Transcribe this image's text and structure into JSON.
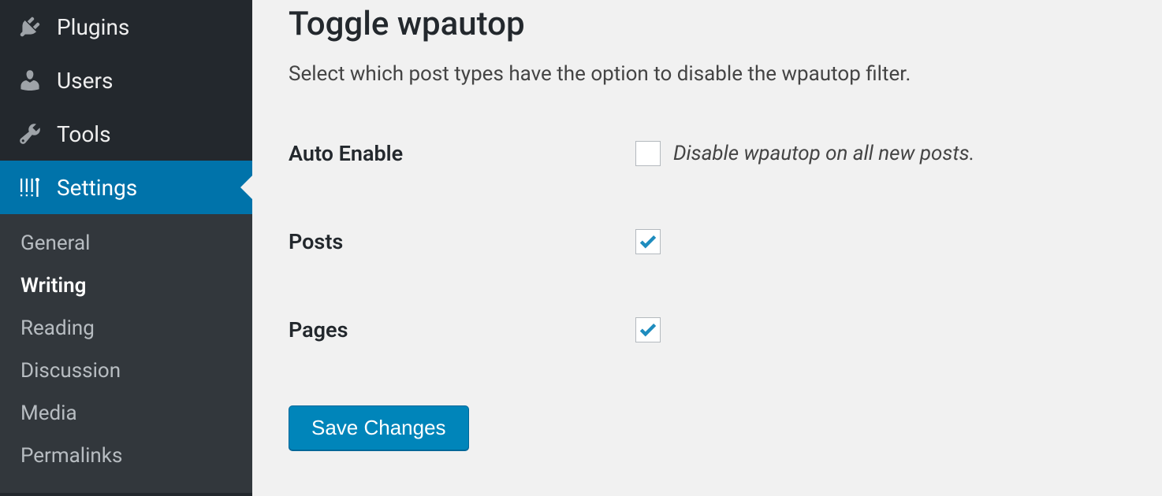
{
  "sidebar": {
    "items": [
      {
        "label": "Plugins",
        "icon": "plugin-icon"
      },
      {
        "label": "Users",
        "icon": "users-icon"
      },
      {
        "label": "Tools",
        "icon": "tools-icon"
      },
      {
        "label": "Settings",
        "icon": "settings-icon"
      }
    ],
    "submenu": [
      {
        "label": "General"
      },
      {
        "label": "Writing"
      },
      {
        "label": "Reading"
      },
      {
        "label": "Discussion"
      },
      {
        "label": "Media"
      },
      {
        "label": "Permalinks"
      }
    ]
  },
  "main": {
    "title": "Toggle wpautop",
    "description": "Select which post types have the option to disable the wpautop filter.",
    "rows": [
      {
        "label": "Auto Enable",
        "desc": "Disable wpautop on all new posts.",
        "checked": false
      },
      {
        "label": "Posts",
        "desc": "",
        "checked": true
      },
      {
        "label": "Pages",
        "desc": "",
        "checked": true
      }
    ],
    "save_label": "Save Changes"
  },
  "colors": {
    "accent": "#0073aa",
    "button": "#0085ba"
  }
}
